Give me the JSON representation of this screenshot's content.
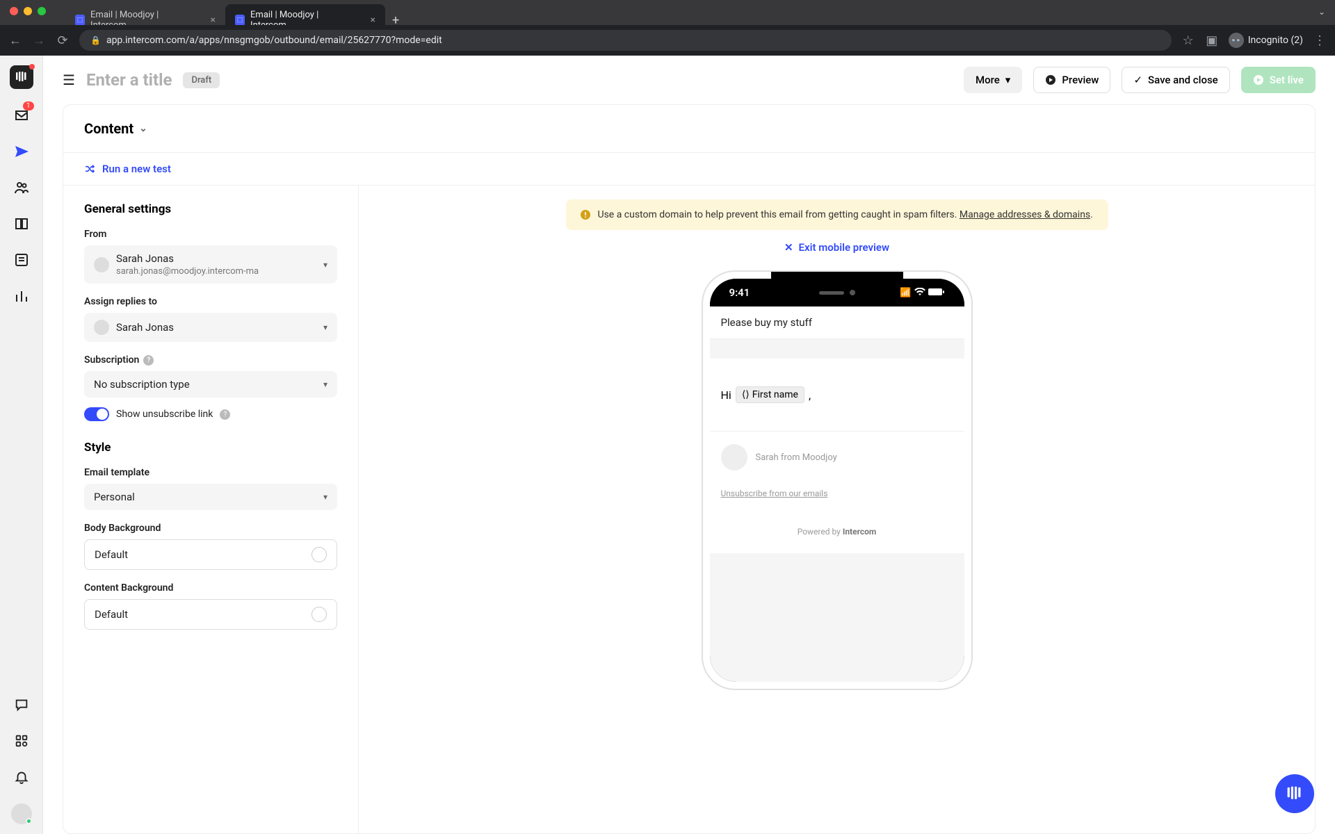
{
  "browser": {
    "tabs": [
      {
        "title": "Email | Moodjoy | Intercom",
        "active": false
      },
      {
        "title": "Email | Moodjoy | Intercom",
        "active": true
      }
    ],
    "url": "app.intercom.com/a/apps/nnsgmgob/outbound/email/25627770?mode=edit",
    "incognito_label": "Incognito (2)"
  },
  "header": {
    "title_placeholder": "Enter a title",
    "status_badge": "Draft",
    "more": "More",
    "preview": "Preview",
    "save": "Save and close",
    "set_live": "Set live"
  },
  "content_section": {
    "title": "Content",
    "run_test": "Run a new test"
  },
  "settings": {
    "general_heading": "General settings",
    "from_label": "From",
    "from_name": "Sarah Jonas",
    "from_email": "sarah.jonas@moodjoy.intercom-ma",
    "assign_label": "Assign replies to",
    "assign_name": "Sarah Jonas",
    "subscription_label": "Subscription",
    "subscription_value": "No subscription type",
    "unsubscribe_toggle_label": "Show unsubscribe link",
    "style_heading": "Style",
    "template_label": "Email template",
    "template_value": "Personal",
    "body_bg_label": "Body Background",
    "body_bg_value": "Default",
    "content_bg_label": "Content Background",
    "content_bg_value": "Default"
  },
  "banner": {
    "text": "Use a custom domain to help prevent this email from getting caught in spam filters. ",
    "link": "Manage addresses & domains"
  },
  "exit_preview": "Exit mobile preview",
  "phone": {
    "time": "9:41",
    "subject": "Please buy my stuff",
    "greeting_prefix": "Hi",
    "greeting_tag": "First name",
    "greeting_suffix": ",",
    "sender": "Sarah from Moodjoy",
    "unsubscribe": "Unsubscribe from our emails",
    "powered_prefix": "Powered by ",
    "powered_brand": "Intercom"
  },
  "rail": {
    "inbox_badge": "1"
  }
}
